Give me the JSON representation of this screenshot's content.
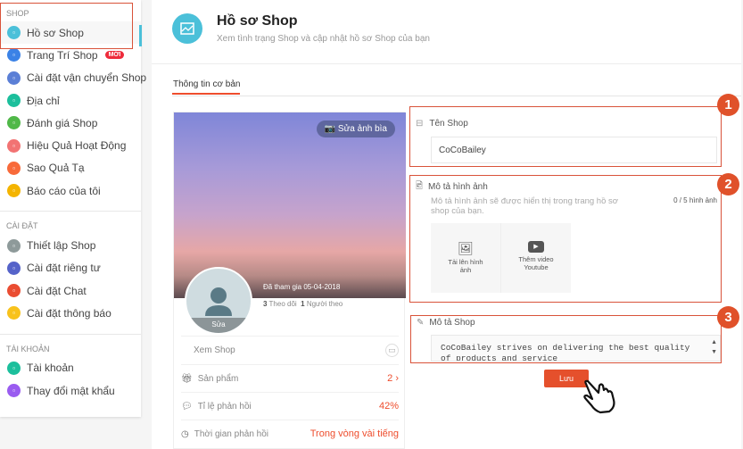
{
  "sidebar": {
    "sections": [
      {
        "title": "SHOP",
        "items": [
          {
            "label": "Hồ sơ Shop",
            "icon": "profile-icon",
            "color": "#4bc0d9"
          },
          {
            "label": "Trang Trí Shop",
            "icon": "decor-icon",
            "color": "#3b82e6",
            "badge": "MỚI"
          },
          {
            "label": "Cài đặt vận chuyển Shop",
            "icon": "truck-icon",
            "color": "#5b7fd6"
          },
          {
            "label": "Địa chỉ",
            "icon": "location-icon",
            "color": "#1cbf9c"
          },
          {
            "label": "Đánh giá Shop",
            "icon": "star-icon",
            "color": "#50b848"
          },
          {
            "label": "Hiệu Quả Hoạt Động",
            "icon": "chart-icon",
            "color": "#f27373"
          },
          {
            "label": "Sao Quả Tạ",
            "icon": "lightning-icon",
            "color": "#f86a3a"
          },
          {
            "label": "Báo cáo của tôi",
            "icon": "report-icon",
            "color": "#f4b400"
          }
        ]
      },
      {
        "title": "CÀI ĐẶT",
        "items": [
          {
            "label": "Thiết lập Shop",
            "icon": "gear-icon",
            "color": "#8e9a9a"
          },
          {
            "label": "Cài đặt riêng tư",
            "icon": "lock-icon",
            "color": "#5563c9"
          },
          {
            "label": "Cài đặt Chat",
            "icon": "chat-icon",
            "color": "#ea4d32"
          },
          {
            "label": "Cài đặt thông báo",
            "icon": "bell-icon",
            "color": "#f8c21c"
          }
        ]
      },
      {
        "title": "TÀI KHOẢN",
        "items": [
          {
            "label": "Tài khoản",
            "icon": "account-icon",
            "color": "#1cbf9c"
          },
          {
            "label": "Thay đổi mật khẩu",
            "icon": "key-icon",
            "color": "#9a5cf0"
          }
        ]
      }
    ]
  },
  "header": {
    "title": "Hồ sơ Shop",
    "subtitle": "Xem tình trạng Shop và cập nhật hồ sơ Shop của bạn"
  },
  "tab": "Thông tin cơ bản",
  "profile": {
    "edit_cover": "Sửa ảnh bìa",
    "joined": "Đã tham gia 05-04-2018",
    "following_count": "3",
    "following_label": "Theo dõi",
    "followers_count": "1",
    "followers_label": "Người theo",
    "avatar_edit": "Sửa",
    "view_shop": "Xem Shop",
    "stats": [
      {
        "label": "Sản phẩm",
        "value": "2 ›",
        "icon": "gift-icon"
      },
      {
        "label": "Tỉ lệ phản hồi",
        "value": "42%",
        "icon": "chat-bubble-icon"
      },
      {
        "label": "Thời gian phản hồi",
        "value": "Trong vòng vài tiếng",
        "icon": "clock-icon"
      }
    ]
  },
  "form": {
    "shop_name_label": "Tên Shop",
    "shop_name_value": "CoCoBailey",
    "image_desc_label": "Mô tả hình ảnh",
    "image_desc_hint": "Mô tả hình ảnh sẽ được hiển thị trong trang hồ sơ shop của bạn.",
    "image_count": "0 / 5 hình ảnh",
    "upload_image": "Tải lên hình ảnh",
    "add_video": "Thêm video Youtube",
    "shop_desc_label": "Mô tả Shop",
    "shop_desc_value": "CoCoBailey strives on delivering the best quality of products and service",
    "save": "Lưu"
  },
  "annotations": [
    "1",
    "2",
    "3"
  ],
  "accent": "#ee4d2d"
}
